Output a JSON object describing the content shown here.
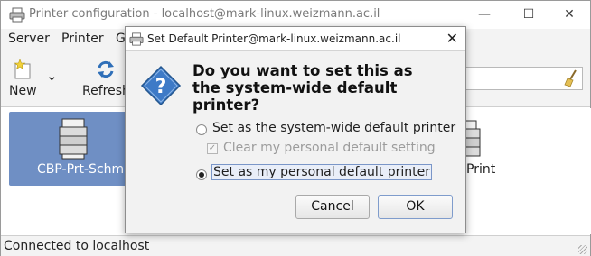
{
  "window": {
    "title": "Printer configuration - localhost@mark-linux.weizmann.ac.il",
    "minimize_glyph": "—",
    "maximize_glyph": "☐",
    "close_glyph": "✕"
  },
  "menubar": {
    "items": [
      "Server",
      "Printer",
      "G"
    ]
  },
  "toolbar": {
    "new_label": "New",
    "refresh_label": "Refresh",
    "dropdown_glyph": "⌄"
  },
  "printers": [
    {
      "name": "CBP-Prt-Schm",
      "selected": true
    },
    {
      "name": "Print",
      "selected": false
    }
  ],
  "statusbar": {
    "text": "Connected to localhost"
  },
  "dialog": {
    "title": "Set Default Printer@mark-linux.weizmann.ac.il",
    "close_glyph": "✕",
    "question": "Do you want to set this as the system-wide default printer?",
    "options": {
      "system_wide": {
        "label": "Set as the system-wide default printer",
        "selected": false
      },
      "clear_personal": {
        "label": "Clear my personal default setting",
        "checked": true,
        "enabled": false
      },
      "personal": {
        "label": "Set as my personal default printer",
        "selected": true
      }
    },
    "cancel_label": "Cancel",
    "ok_label": "OK"
  },
  "colors": {
    "selection_tile": "#6f8fc4",
    "question_icon": "#3d7ac7",
    "default_button_border": "#7f9ccc"
  }
}
